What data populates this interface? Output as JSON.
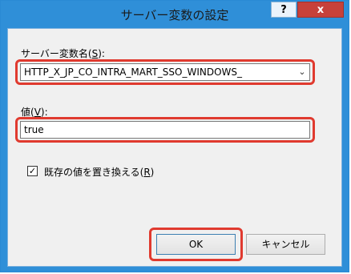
{
  "window": {
    "title": "サーバー変数の設定",
    "help_label": "?",
    "close_label": "x"
  },
  "form": {
    "name_label": "サーバー変数名(",
    "name_label_accel": "S",
    "name_label_end": "):",
    "name_value": "HTTP_X_JP_CO_INTRA_MART_SSO_WINDOWS_",
    "value_label": "値(",
    "value_label_accel": "V",
    "value_label_end": "):",
    "value_value": "true",
    "replace_checkbox_checked": true,
    "replace_label": "既存の値を置き換える(",
    "replace_label_accel": "R",
    "replace_label_end": ")"
  },
  "buttons": {
    "ok": "OK",
    "cancel": "キャンセル"
  },
  "colors": {
    "titlebar": "#2f8fd8",
    "close": "#c7413a",
    "highlight": "#e03a2f"
  }
}
